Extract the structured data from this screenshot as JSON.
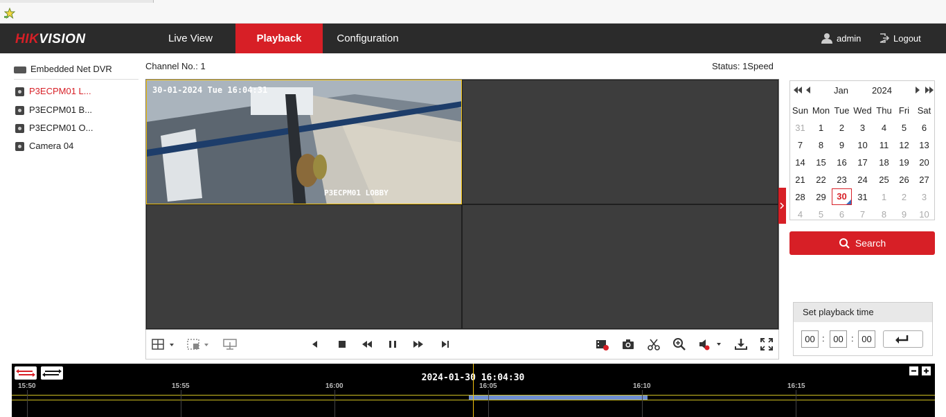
{
  "nav": {
    "logo_hik": "HIK",
    "logo_vision": "VISION",
    "tabs": [
      {
        "label": "Live View"
      },
      {
        "label": "Playback"
      },
      {
        "label": "Configuration"
      }
    ],
    "user": "admin",
    "logout": "Logout"
  },
  "sidebar": {
    "device": "Embedded Net DVR",
    "cameras": [
      {
        "label": "P3ECPM01 L..."
      },
      {
        "label": "P3ECPM01 B..."
      },
      {
        "label": "P3ECPM01 O..."
      },
      {
        "label": "Camera 04"
      }
    ]
  },
  "player": {
    "channel": "Channel No.: 1",
    "status": "Status: 1Speed",
    "osd_time": "30-01-2024 Tue 16:04:31",
    "osd_name": "P3ECPM01 LOBBY"
  },
  "calendar": {
    "month": "Jan",
    "year": "2024",
    "weekdays": [
      "Sun",
      "Mon",
      "Tue",
      "Wed",
      "Thu",
      "Fri",
      "Sat"
    ],
    "weeks": [
      [
        "31",
        "1",
        "2",
        "3",
        "4",
        "5",
        "6"
      ],
      [
        "7",
        "8",
        "9",
        "10",
        "11",
        "12",
        "13"
      ],
      [
        "14",
        "15",
        "16",
        "17",
        "18",
        "19",
        "20"
      ],
      [
        "21",
        "22",
        "23",
        "24",
        "25",
        "26",
        "27"
      ],
      [
        "28",
        "29",
        "30",
        "31",
        "1",
        "2",
        "3"
      ],
      [
        "4",
        "5",
        "6",
        "7",
        "8",
        "9",
        "10"
      ]
    ],
    "selected": "30"
  },
  "search_label": "Search",
  "playback_time": {
    "title": "Set playback time",
    "hh": "00",
    "mm": "00",
    "ss": "00"
  },
  "timeline": {
    "current": "2024-01-30 16:04:30",
    "ticks": [
      "15:50",
      "15:55",
      "16:00",
      "16:05",
      "16:10",
      "16:15"
    ],
    "record_color": "#6f8fd0",
    "cursor_color": "#f4c20d"
  }
}
